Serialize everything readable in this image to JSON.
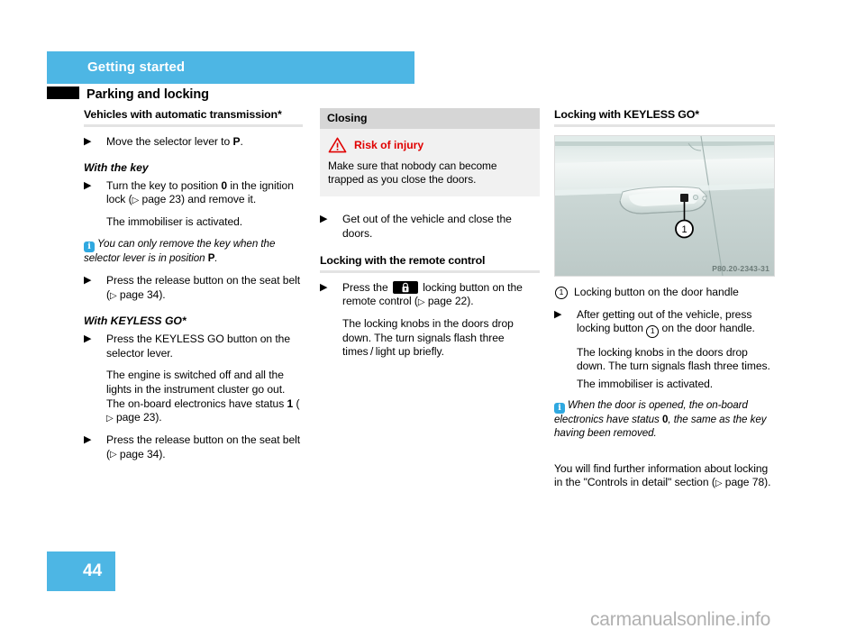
{
  "header": {
    "chapter_title": "Getting started",
    "page_title": "Parking and locking",
    "accent_color": "#4db6e4"
  },
  "footer": {
    "page_number": "44",
    "watermark": "carmanualsonline.info"
  },
  "left_column": {
    "section_heading": "Vehicles with automatic transmission*",
    "step_1": "Move the selector lever to ",
    "step_1_bold": "P",
    "step_1_end": ".",
    "subhead_key": "With the key",
    "step_key_1a": "Turn the key to position ",
    "step_key_1_bold": "0",
    "step_key_1b": " in the ignition lock (",
    "step_key_1_xref": " page 23",
    "step_key_1c": ") and remove it.",
    "result_key": "The immobiliser is activated.",
    "note_key_a": "You can only remove the key when the selector lever is in position ",
    "note_key_bold": "P",
    "note_key_b": ".",
    "step_key_2a": "Press the release button on the seat belt (",
    "step_key_2_xref": " page 34",
    "step_key_2b": ").",
    "subhead_keyless": "With KEYLESS GO*",
    "step_kg_1": "Press the KEYLESS GO button on the selector lever.",
    "result_kg_a": "The engine is switched off and all the lights in the instrument cluster go out. The on-board electronics have status ",
    "result_kg_bold": "1",
    "result_kg_b": " (",
    "result_kg_xref": " page 23",
    "result_kg_c": ").",
    "step_kg_2a": "Press the release button on the seat belt (",
    "step_kg_2_xref": " page 34",
    "step_kg_2b": ")."
  },
  "middle_column": {
    "panel_title": "Closing",
    "warning_title": "Risk of injury",
    "warning_icon": "warning-triangle-icon",
    "warning_text": "Make sure that nobody can become trapped as you close the doors.",
    "step_1": "Get out of the vehicle and close the doors.",
    "section_heading": "Locking with the remote control",
    "step_2a": "Press the ",
    "step_2_icon": "lock-button-icon",
    "step_2b": " locking button on the remote control (",
    "step_2_xref": " page 22",
    "step_2c": ").",
    "result_2": "The locking knobs in the doors drop down. The turn signals flash three times / light up briefly."
  },
  "right_column": {
    "section_heading": "Locking with KEYLESS GO*",
    "figure": {
      "alt": "car-door-handle-illustration",
      "callout_number": "1",
      "image_code": "P80.20-2343-31"
    },
    "legend_number": "1",
    "legend_text": "Locking button on the door handle",
    "step_1a": "After getting out of the vehicle, press locking button ",
    "step_1_callout": "1",
    "step_1b": " on the door handle.",
    "result_1": "The locking knobs in the doors drop down. The turn signals flash three times.",
    "result_2": "The immobiliser is activated.",
    "note_a": "When the door is opened, the on-board electronics have status ",
    "note_bold": "0",
    "note_b": ", the same as the key having been removed.",
    "closing_para_a": "You will find further information about locking in the \"Controls in detail\" section (",
    "closing_para_xref": " page 78",
    "closing_para_b": ")."
  }
}
